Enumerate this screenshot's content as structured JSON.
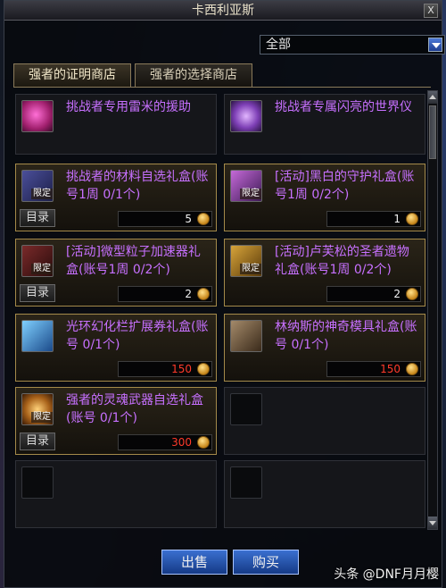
{
  "window": {
    "title": "卡西利亚斯",
    "close_label": "X"
  },
  "filter": {
    "value": "全部"
  },
  "tabs": [
    {
      "label": "强者的证明商店",
      "active": true
    },
    {
      "label": "强者的选择商店",
      "active": false
    }
  ],
  "items": [
    {
      "name": "挑战者专用雷米的援助",
      "icon": "pink-orb-icon",
      "limited": false,
      "menu": "",
      "price": ""
    },
    {
      "name": "挑战者专属闪亮的世界仪",
      "icon": "purple-orb-icon",
      "limited": false,
      "menu": "",
      "price": ""
    },
    {
      "name": "挑战者的材料自选礼盒(账号1周 0/1个)",
      "icon": "box-icon",
      "limited": true,
      "limited_label": "限定",
      "menu": "目录",
      "price": "5",
      "price_color": "white"
    },
    {
      "name": "[活动]黑白的守护礼盒(账号1周 0/2个)",
      "icon": "gift-icon",
      "limited": true,
      "limited_label": "限定",
      "menu": "",
      "price": "1",
      "price_color": "white"
    },
    {
      "name": "[活动]微型粒子加速器礼盒(账号1周 0/2个)",
      "icon": "box-icon",
      "limited": true,
      "limited_label": "限定",
      "menu": "目录",
      "price": "2",
      "price_color": "white"
    },
    {
      "name": "[活动]卢芙松的圣者遗物礼盒(账号1周 0/2个)",
      "icon": "relic-icon",
      "limited": true,
      "limited_label": "限定",
      "menu": "",
      "price": "2",
      "price_color": "white"
    },
    {
      "name": "光环幻化栏扩展券礼盒(账号 0/1个)",
      "icon": "ticket-icon",
      "limited": false,
      "menu": "",
      "price": "150",
      "price_color": "red"
    },
    {
      "name": "林纳斯的神奇模具礼盒(账号 0/1个)",
      "icon": "mold-icon",
      "limited": false,
      "menu": "",
      "price": "150",
      "price_color": "red"
    },
    {
      "name": "强者的灵魂武器自选礼盒(账号 0/1个)",
      "icon": "soul-weapon-icon",
      "limited": true,
      "limited_label": "限定",
      "menu": "目录",
      "price": "300",
      "price_color": "red"
    }
  ],
  "buttons": {
    "sell": "出售",
    "buy": "购买"
  },
  "watermark": "头条 @DNF月月樱"
}
